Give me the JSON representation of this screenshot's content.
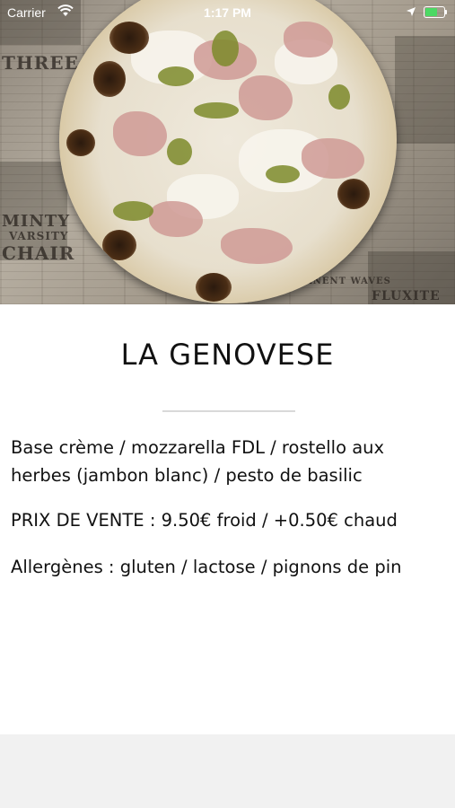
{
  "status_bar": {
    "carrier": "Carrier",
    "time": "1:17 PM"
  },
  "hero": {
    "icon": "pizza-photo",
    "newspaper_text": [
      "THREE NUNS",
      "MINTY",
      "VARSITY",
      "CHAIR",
      "FLUXITE",
      "ANENT WAVES"
    ]
  },
  "product": {
    "name": "LA GENOVESE",
    "description": "Base crème / mozzarella FDL / rostello aux herbes (jambon blanc) / pesto de basilic",
    "price": "PRIX DE VENTE : 9.50€ froid / +0.50€ chaud",
    "allergens": "Allergènes : gluten / lactose / pignons de pin"
  },
  "colors": {
    "background": "#ffffff",
    "bottom_bar": "#f1f1f1",
    "divider": "#d9d9d9",
    "battery": "#4cd964"
  }
}
